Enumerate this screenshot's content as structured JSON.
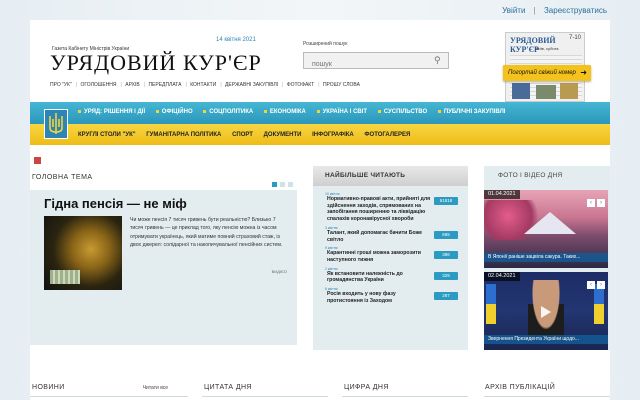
{
  "topbar": {
    "login": "Увійти",
    "separator": "|",
    "register": "Зареєструватись"
  },
  "header": {
    "gov_text": "Газета Кабінету Міністрів України",
    "date": "14 квітня 2021",
    "logo": "УРЯДОВИЙ КУР'ЄР",
    "advanced_search": "Розширений пошук",
    "search_placeholder": "пошук",
    "menu": [
      "ПРО \"УК\"",
      "ОГОЛОШЕННЯ",
      "АРХІВ",
      "ПЕРЕДПЛАТА",
      "КОНТАКТИ",
      "ДЕРЖАВНІ ЗАКУПІВЛІ",
      "ФОТОФАКТ",
      "ПРОШУ СЛОВА"
    ]
  },
  "paper": {
    "title": "УРЯДОВИЙ КУР'ЄР",
    "number": "7-10",
    "city": "Київ, субота",
    "subscribe": "Погортай свіжий номер"
  },
  "nav_primary": [
    "УРЯД: РІШЕННЯ І ДІЇ",
    "ОФІЦІЙНО",
    "СОЦПОЛІТИКА",
    "ЕКОНОМІКА",
    "УКРАЇНА І СВІТ",
    "СУСПІЛЬСТВО",
    "ПУБЛІЧНІ ЗАКУПІВЛІ"
  ],
  "nav_secondary": [
    "КРУГЛІ СТОЛИ \"УК\"",
    "ГУМАНІТАРНА ПОЛІТИКА",
    "СПОРТ",
    "ДОКУМЕНТИ",
    "ІНФОГРАФІКА",
    "ФОТОГАЛЕРЕЯ"
  ],
  "main_topic": {
    "section": "ГОЛОВНА ТЕМА",
    "headline": "Гідна пенсія — не міф",
    "text": "Чи може пенсія 7 тисяч гривень бути реальністю? Близько 7 тисяч гривень — це приклад того, яку пенсію можна із часом отримувати українець, який матиме повний страховий стаж, із двох джерел: солідарної та накопичувальної пенсійних систем.",
    "more": "ВИДІЄО"
  },
  "popular": {
    "section": "НАЙБІЛЬШЕ ЧИТАЮТЬ",
    "items": [
      {
        "date": "10 квітня",
        "text": "Нормативно-правові акти, прийняті для здійснення заходів, спрямованих на запобігання поширенню та ліквідацію спалахів коронавірусної хвороби",
        "count": "51818"
      },
      {
        "date": "3 квітня",
        "text": "Талант, який допомагає бачити Боже світло",
        "count": "665"
      },
      {
        "date": "9 квітня",
        "text": "Карантинні гроші можна заморозити наступного тижня",
        "count": "386"
      },
      {
        "date": "2 квітня",
        "text": "Як встановити належність до громадянства України",
        "count": "329"
      },
      {
        "date": "6 квітня",
        "text": "Росія входить у нову фазу протистояння із Заходом",
        "count": "287"
      }
    ]
  },
  "media": {
    "section": "ФОТО І ВІДЕО ДНЯ",
    "cards": [
      {
        "date": "01.04.2021",
        "caption": "В Японії раніше зацвіла сакура. Таких..."
      },
      {
        "date": "02.04.2021",
        "caption": "Звернення Президента України щодо..."
      }
    ],
    "prev": "‹",
    "next": "›"
  },
  "bottom": {
    "news": "НОВИНИ",
    "read_all": "Читати все",
    "quote": "ЦИТАТА ДНЯ",
    "figure": "ЦИФРА ДНЯ",
    "archive": "АРХІВ ПУБЛІКАЦІЙ"
  }
}
